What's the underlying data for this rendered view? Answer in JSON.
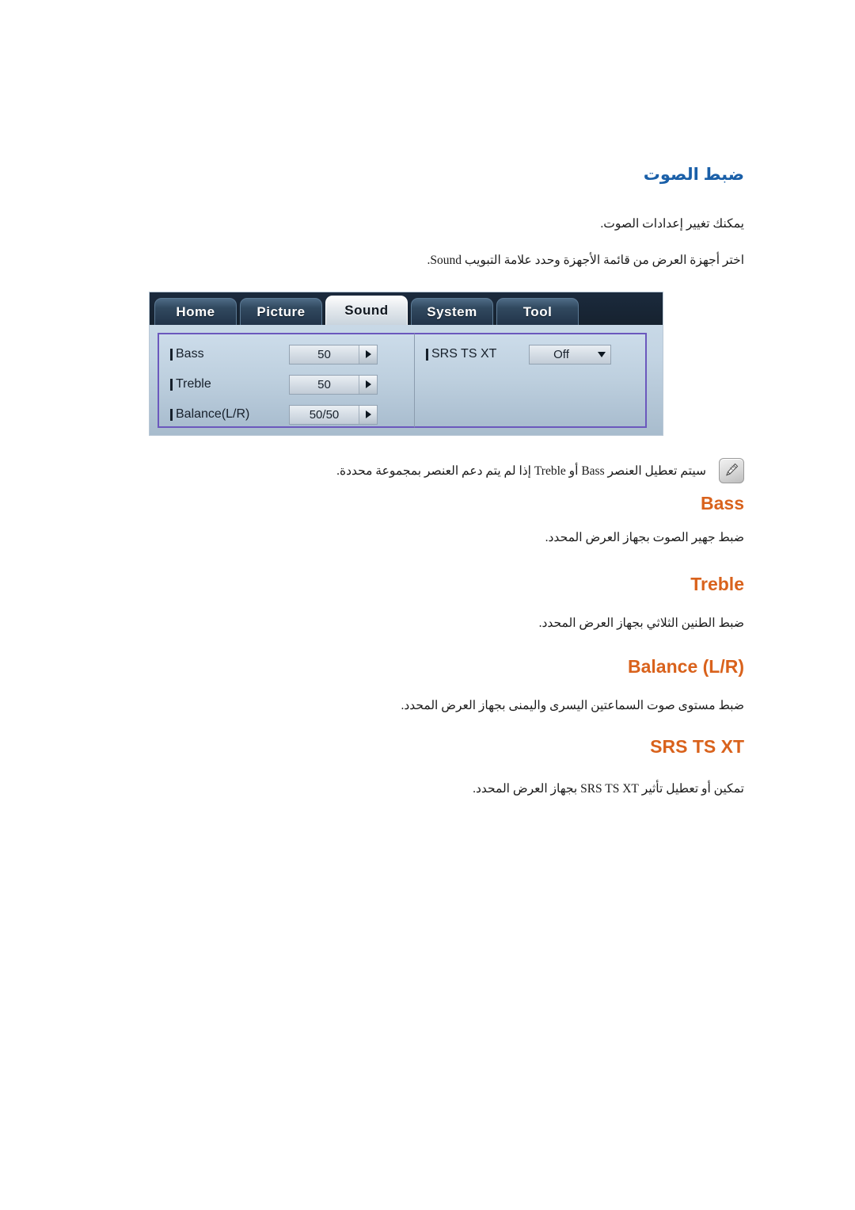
{
  "document": {
    "language": "ar",
    "title_color": "#1a5fa8",
    "heading_color": "#d9621c"
  },
  "section": {
    "title": "ضبط الصوت",
    "intro_line_1": "يمكنك تغيير إعدادات الصوت.",
    "intro_line_2": "اختر أجهزة العرض من قائمة الأجهزة وحدد علامة التبويب Sound."
  },
  "note": {
    "icon": "note-pencil-icon",
    "text": "سيتم تعطيل العنصر Bass أو Treble إذا لم يتم دعم العنصر بمجموعة محددة."
  },
  "osd": {
    "tabs": [
      {
        "label": "Home",
        "active": false
      },
      {
        "label": "Picture",
        "active": false
      },
      {
        "label": "Sound",
        "active": true
      },
      {
        "label": "System",
        "active": false
      },
      {
        "label": "Tool",
        "active": false
      }
    ],
    "left_rows": [
      {
        "label": "Bass",
        "value": "50",
        "control": "stepper-arrow-right"
      },
      {
        "label": "Treble",
        "value": "50",
        "control": "stepper-arrow-right"
      },
      {
        "label": "Balance(L/R)",
        "value": "50/50",
        "control": "stepper-arrow-right"
      }
    ],
    "right_rows": [
      {
        "label": "SRS TS XT",
        "value": "Off",
        "control": "dropdown-arrow-down"
      }
    ],
    "highlight_color": "#6b58bd"
  },
  "topics": [
    {
      "heading": "Bass",
      "description": "ضبط جهير الصوت بجهاز العرض المحدد."
    },
    {
      "heading": "Treble",
      "description": "ضبط الطنين الثلاثي بجهاز العرض المحدد."
    },
    {
      "heading": "Balance (L/R)",
      "description": "ضبط مستوى صوت السماعتين اليسرى واليمنى بجهاز العرض المحدد."
    },
    {
      "heading": "SRS TS XT",
      "description": "تمكين أو تعطيل تأثير SRS TS XT بجهاز العرض المحدد."
    }
  ]
}
